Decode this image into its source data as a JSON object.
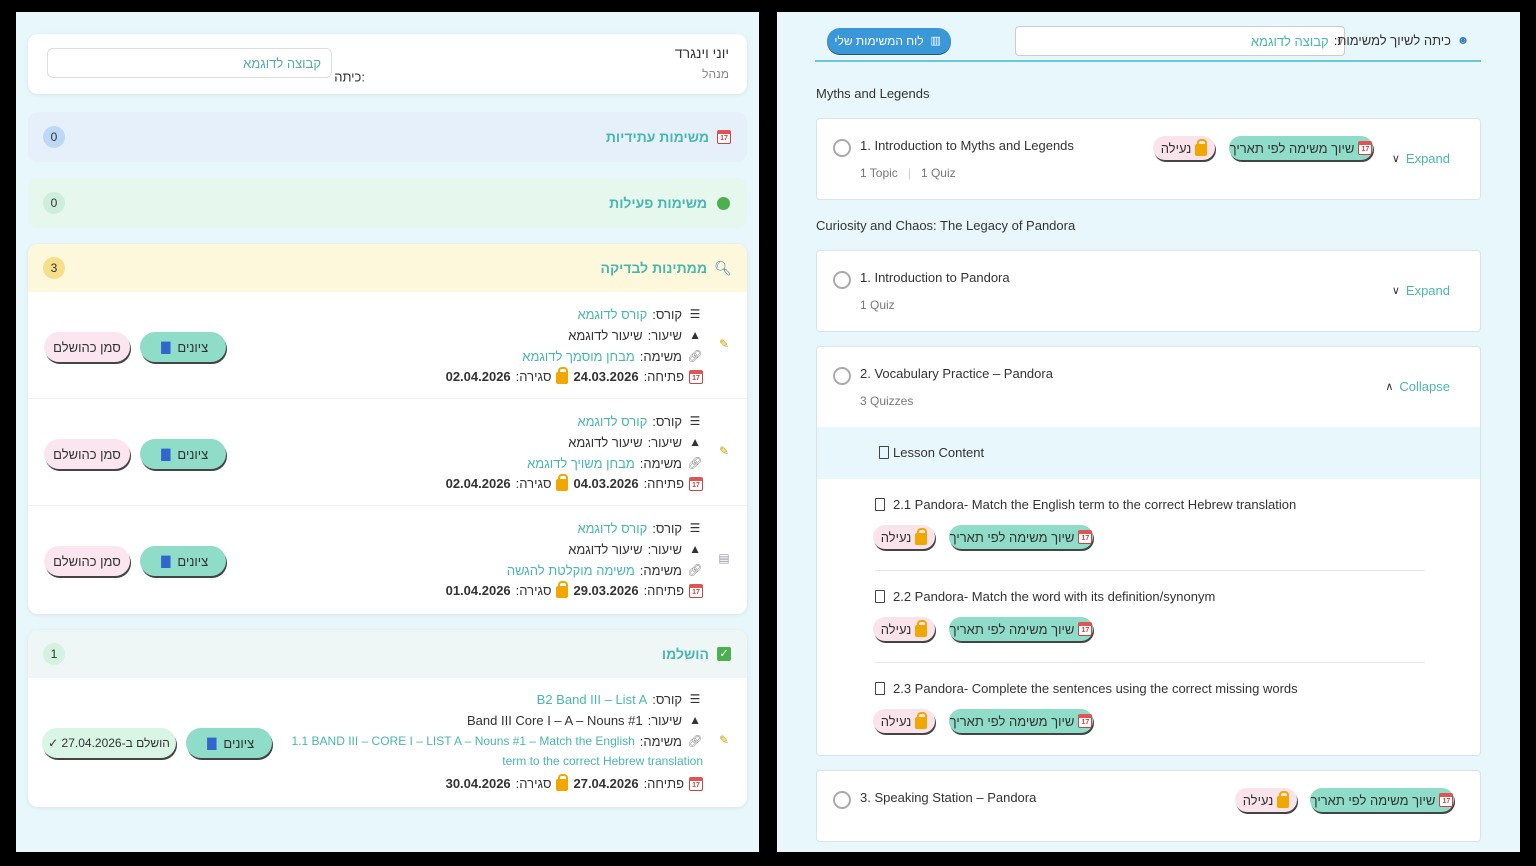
{
  "left": {
    "user": {
      "name": "יוני וינגרד",
      "role": "מנהל",
      "class_label": "כיתה:",
      "class_value": "קבוצה לדוגמא"
    },
    "sections": {
      "future": {
        "title": "משימות עתידיות",
        "count": "0"
      },
      "active": {
        "title": "משימות פעילות",
        "count": "0"
      },
      "pending": {
        "title": "ממתינות לבדיקה",
        "count": "3"
      },
      "done": {
        "title": "הושלמו",
        "count": "1"
      }
    },
    "labels": {
      "course": "קורס:",
      "lesson": "שיעור:",
      "task": "משימה:",
      "open": "פתיחה:",
      "close": "סגירה:"
    },
    "buttons": {
      "grades": "ציונים",
      "mark_done": "סמן כהושלם"
    },
    "pending_items": [
      {
        "course": "קורס לדוגמא",
        "lesson": "שיעור לדוגמא",
        "task": "מבחן מוסמך לדוגמא",
        "open": "24.03.2026",
        "close": "02.04.2026"
      },
      {
        "course": "קורס לדוגמא",
        "lesson": "שיעור לדוגמא",
        "task": "מבחן משויך לדוגמא",
        "open": "04.03.2026",
        "close": "02.04.2026"
      },
      {
        "course": "קורס לדוגמא",
        "lesson": "שיעור לדוגמא",
        "task": "משימה מוקלטת להגשה",
        "open": "29.03.2026",
        "close": "01.04.2026"
      }
    ],
    "done_item": {
      "course": "B2 Band III – List A",
      "lesson": "Band III Core I – A – Nouns #1",
      "task_line1": "1.1 BAND III – CORE I – LIST A – Nouns #1 – Match the English",
      "task_line2": "term to the correct Hebrew translation",
      "open": "27.04.2026",
      "close": "30.04.2026",
      "completed": "הושלם ב-27.04.2026 ✓"
    }
  },
  "right": {
    "board_button": "לוח המשימות שלי",
    "class_label": "כיתה לשיוך למשימות:",
    "class_value": "קבוצה לדוגמא",
    "lock_label": "נעילה",
    "assign_label": "שיוך משימה לפי תאריך",
    "module1": {
      "title": "Myths and Legends",
      "lesson": {
        "title": "1. Introduction to Myths and Legends",
        "meta1": "1 Topic",
        "meta2": "1 Quiz",
        "action": "Expand"
      }
    },
    "module2": {
      "title": "Curiosity and Chaos: The Legacy of Pandora",
      "lesson1": {
        "title": "1. Introduction to Pandora",
        "meta1": "1 Quiz",
        "action": "Expand"
      },
      "lesson2": {
        "title": "2. Vocabulary Practice – Pandora",
        "meta1": "3 Quizzes",
        "action": "Collapse",
        "content_label": "Lesson Content",
        "items": [
          "2.1 Pandora- Match the English term to the correct Hebrew translation",
          "2.2 Pandora- Match the word with its definition/synonym",
          "2.3 Pandora- Complete the sentences using the correct missing words"
        ]
      },
      "lesson3": {
        "title": "3. Speaking Station – Pandora"
      }
    }
  }
}
